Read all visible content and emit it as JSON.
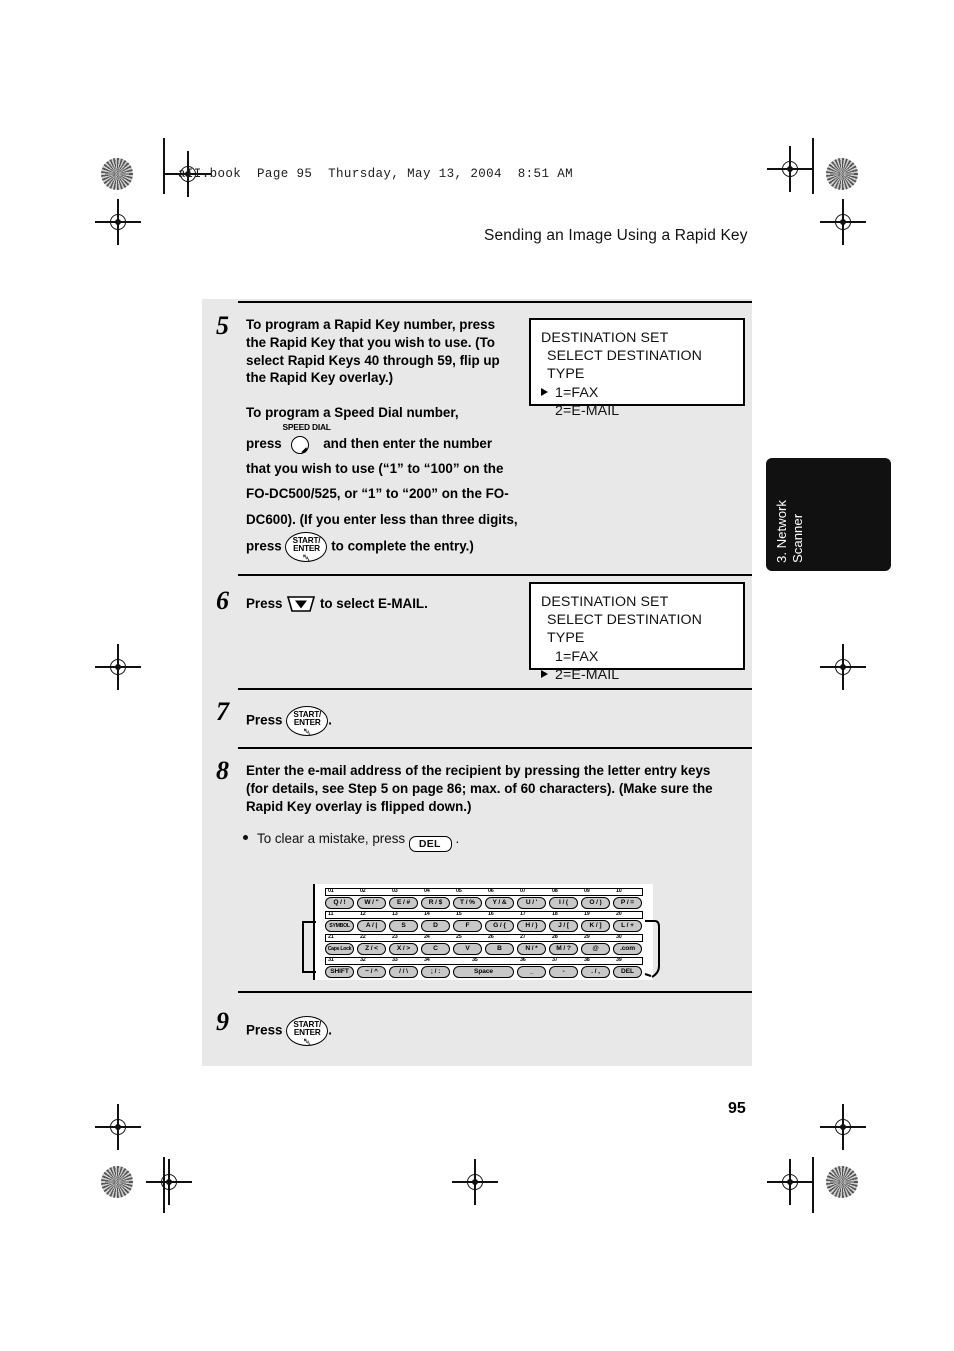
{
  "page": {
    "filestamp": "aII.book  Page 95  Thursday, May 13, 2004  8:51 AM",
    "running_head": "Sending an Image Using a Rapid Key",
    "page_number": "95",
    "side_tab": "3. Network\nScanner"
  },
  "steps": [
    {
      "number": "5",
      "para1": "To program a Rapid Key number, press the Rapid Key that you wish to use. (To select Rapid Keys 40 through 59, flip up the Rapid Key overlay.)",
      "para2_a": "To program a Speed Dial number,",
      "para2_b": "press",
      "para2_c": "and then enter the number that you wish to use (“1” to “100” on the FO-DC500/525, or “1” to “200” on the FO-DC600). (If you enter",
      "para2_d": "less than three digits, press",
      "para2_e": "to",
      "para2_f": "complete the entry.)"
    },
    {
      "number": "6",
      "text_a": "Press",
      "text_b": "to select E-MAIL."
    },
    {
      "number": "7",
      "text_a": "Press",
      "text_b": "."
    },
    {
      "number": "8",
      "text": "Enter the e-mail address of the recipient by pressing the letter entry keys (for details, see Step 5 on page 86; max. of 60 characters). (Make sure the Rapid Key overlay is flipped down.)",
      "bullet_a": "To clear a mistake, press",
      "bullet_b": "."
    },
    {
      "number": "9",
      "text_a": "Press",
      "text_b": "."
    }
  ],
  "lcd_panels": [
    {
      "line1": "DESTINATION SET",
      "line2": "SELECT DESTINATION TYPE",
      "options": [
        {
          "label": "1=FAX",
          "selected": true
        },
        {
          "label": "2=E-MAIL",
          "selected": false
        }
      ]
    },
    {
      "line1": "DESTINATION SET",
      "line2": "SELECT DESTINATION TYPE",
      "options": [
        {
          "label": "1=FAX",
          "selected": false
        },
        {
          "label": "2=E-MAIL",
          "selected": true
        }
      ]
    }
  ],
  "key_glyphs": {
    "start_enter_top": "START/",
    "start_enter_bottom": "ENTER",
    "speed_dial": "SPEED DIAL",
    "del": "DEL"
  },
  "keyboard": {
    "rows": [
      {
        "numbers": [
          "01",
          "02",
          "03",
          "04",
          "05",
          "06",
          "07",
          "08",
          "09",
          "10"
        ],
        "keys": [
          "Q / !",
          "W / \"",
          "E / #",
          "R / $",
          "T / %",
          "Y / &",
          "U / '",
          "I / (",
          "O / )",
          "P / ="
        ]
      },
      {
        "numbers": [
          "11",
          "12",
          "13",
          "14",
          "15",
          "16",
          "17",
          "18",
          "19",
          "20"
        ],
        "keys": [
          "SYMBOL",
          "A / |",
          "S",
          "D",
          "F",
          "G / {",
          "H / }",
          "J / [",
          "K / ]",
          "L / +"
        ]
      },
      {
        "numbers": [
          "21",
          "22",
          "23",
          "24",
          "25",
          "26",
          "27",
          "28",
          "29",
          "30"
        ],
        "keys": [
          "Caps Lock",
          "Z / <",
          "X / >",
          "C",
          "V",
          "B",
          "N / *",
          "M / ?",
          "@",
          ".com"
        ]
      },
      {
        "numbers": [
          "31",
          "32",
          "33",
          "34",
          "35",
          "36",
          "37",
          "38",
          "39"
        ],
        "keys": [
          "SHIFT",
          "~ / ^",
          "/ / \\",
          ";  /  :",
          "Space",
          "_",
          "-",
          ". / ,",
          "DEL"
        ]
      }
    ]
  },
  "colors": {
    "panel_bg": "#e8e8e8",
    "keycap": "#c8c8c8",
    "tab_bg": "#111111",
    "ink": "#000000"
  }
}
